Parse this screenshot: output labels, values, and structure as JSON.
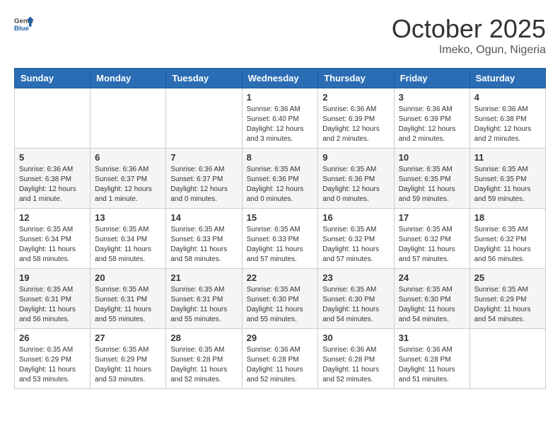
{
  "header": {
    "logo_general": "General",
    "logo_blue": "Blue",
    "month": "October 2025",
    "location": "Imeko, Ogun, Nigeria"
  },
  "days_of_week": [
    "Sunday",
    "Monday",
    "Tuesday",
    "Wednesday",
    "Thursday",
    "Friday",
    "Saturday"
  ],
  "weeks": [
    [
      {
        "day": "",
        "info": ""
      },
      {
        "day": "",
        "info": ""
      },
      {
        "day": "",
        "info": ""
      },
      {
        "day": "1",
        "info": "Sunrise: 6:36 AM\nSunset: 6:40 PM\nDaylight: 12 hours and 3 minutes."
      },
      {
        "day": "2",
        "info": "Sunrise: 6:36 AM\nSunset: 6:39 PM\nDaylight: 12 hours and 2 minutes."
      },
      {
        "day": "3",
        "info": "Sunrise: 6:36 AM\nSunset: 6:39 PM\nDaylight: 12 hours and 2 minutes."
      },
      {
        "day": "4",
        "info": "Sunrise: 6:36 AM\nSunset: 6:38 PM\nDaylight: 12 hours and 2 minutes."
      }
    ],
    [
      {
        "day": "5",
        "info": "Sunrise: 6:36 AM\nSunset: 6:38 PM\nDaylight: 12 hours and 1 minute."
      },
      {
        "day": "6",
        "info": "Sunrise: 6:36 AM\nSunset: 6:37 PM\nDaylight: 12 hours and 1 minute."
      },
      {
        "day": "7",
        "info": "Sunrise: 6:36 AM\nSunset: 6:37 PM\nDaylight: 12 hours and 0 minutes."
      },
      {
        "day": "8",
        "info": "Sunrise: 6:35 AM\nSunset: 6:36 PM\nDaylight: 12 hours and 0 minutes."
      },
      {
        "day": "9",
        "info": "Sunrise: 6:35 AM\nSunset: 6:36 PM\nDaylight: 12 hours and 0 minutes."
      },
      {
        "day": "10",
        "info": "Sunrise: 6:35 AM\nSunset: 6:35 PM\nDaylight: 11 hours and 59 minutes."
      },
      {
        "day": "11",
        "info": "Sunrise: 6:35 AM\nSunset: 6:35 PM\nDaylight: 11 hours and 59 minutes."
      }
    ],
    [
      {
        "day": "12",
        "info": "Sunrise: 6:35 AM\nSunset: 6:34 PM\nDaylight: 11 hours and 58 minutes."
      },
      {
        "day": "13",
        "info": "Sunrise: 6:35 AM\nSunset: 6:34 PM\nDaylight: 11 hours and 58 minutes."
      },
      {
        "day": "14",
        "info": "Sunrise: 6:35 AM\nSunset: 6:33 PM\nDaylight: 11 hours and 58 minutes."
      },
      {
        "day": "15",
        "info": "Sunrise: 6:35 AM\nSunset: 6:33 PM\nDaylight: 11 hours and 57 minutes."
      },
      {
        "day": "16",
        "info": "Sunrise: 6:35 AM\nSunset: 6:32 PM\nDaylight: 11 hours and 57 minutes."
      },
      {
        "day": "17",
        "info": "Sunrise: 6:35 AM\nSunset: 6:32 PM\nDaylight: 11 hours and 57 minutes."
      },
      {
        "day": "18",
        "info": "Sunrise: 6:35 AM\nSunset: 6:32 PM\nDaylight: 11 hours and 56 minutes."
      }
    ],
    [
      {
        "day": "19",
        "info": "Sunrise: 6:35 AM\nSunset: 6:31 PM\nDaylight: 11 hours and 56 minutes."
      },
      {
        "day": "20",
        "info": "Sunrise: 6:35 AM\nSunset: 6:31 PM\nDaylight: 11 hours and 55 minutes."
      },
      {
        "day": "21",
        "info": "Sunrise: 6:35 AM\nSunset: 6:31 PM\nDaylight: 11 hours and 55 minutes."
      },
      {
        "day": "22",
        "info": "Sunrise: 6:35 AM\nSunset: 6:30 PM\nDaylight: 11 hours and 55 minutes."
      },
      {
        "day": "23",
        "info": "Sunrise: 6:35 AM\nSunset: 6:30 PM\nDaylight: 11 hours and 54 minutes."
      },
      {
        "day": "24",
        "info": "Sunrise: 6:35 AM\nSunset: 6:30 PM\nDaylight: 11 hours and 54 minutes."
      },
      {
        "day": "25",
        "info": "Sunrise: 6:35 AM\nSunset: 6:29 PM\nDaylight: 11 hours and 54 minutes."
      }
    ],
    [
      {
        "day": "26",
        "info": "Sunrise: 6:35 AM\nSunset: 6:29 PM\nDaylight: 11 hours and 53 minutes."
      },
      {
        "day": "27",
        "info": "Sunrise: 6:35 AM\nSunset: 6:29 PM\nDaylight: 11 hours and 53 minutes."
      },
      {
        "day": "28",
        "info": "Sunrise: 6:35 AM\nSunset: 6:28 PM\nDaylight: 11 hours and 52 minutes."
      },
      {
        "day": "29",
        "info": "Sunrise: 6:36 AM\nSunset: 6:28 PM\nDaylight: 11 hours and 52 minutes."
      },
      {
        "day": "30",
        "info": "Sunrise: 6:36 AM\nSunset: 6:28 PM\nDaylight: 11 hours and 52 minutes."
      },
      {
        "day": "31",
        "info": "Sunrise: 6:36 AM\nSunset: 6:28 PM\nDaylight: 11 hours and 51 minutes."
      },
      {
        "day": "",
        "info": ""
      }
    ]
  ]
}
